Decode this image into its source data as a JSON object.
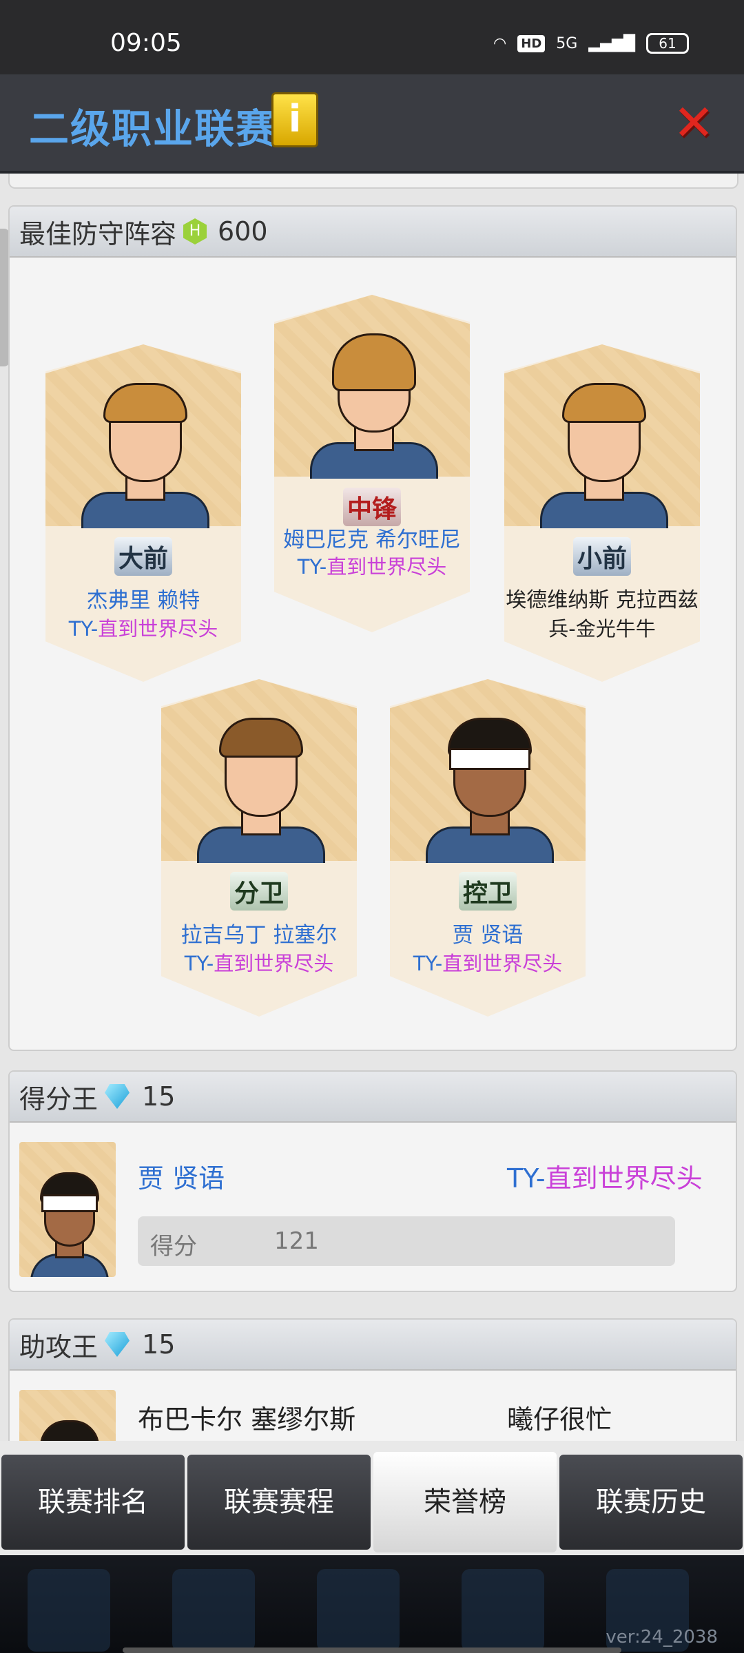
{
  "status_bar": {
    "time": "09:05",
    "network": "5G",
    "hd": "HD",
    "battery": "61"
  },
  "header": {
    "title": "二级职业联赛",
    "info_icon": "i",
    "close_icon": "✕"
  },
  "defense": {
    "title": "最佳防守阵容",
    "badge": "H",
    "points": "600",
    "players": [
      {
        "pos": "大前",
        "name": "杰弗里 赖特",
        "team_ty": "TY-",
        "team_rest": "直到世界尽头"
      },
      {
        "pos": "中锋",
        "name": "姆巴尼克 希尔旺尼",
        "team_ty": "TY-",
        "team_rest": "直到世界尽头"
      },
      {
        "pos": "小前",
        "name": "埃德维纳斯 克拉西兹",
        "team": "兵-金光牛牛"
      },
      {
        "pos": "分卫",
        "name": "拉吉乌丁 拉塞尔",
        "team_ty": "TY-",
        "team_rest": "直到世界尽头"
      },
      {
        "pos": "控卫",
        "name": "贾 贤语",
        "team_ty": "TY-",
        "team_rest": "直到世界尽头"
      }
    ]
  },
  "scoring": {
    "title": "得分王",
    "reward": "15",
    "player": "贾 贤语",
    "team_ty": "TY-",
    "team_rest": "直到世界尽头",
    "stat_label": "得分",
    "stat_value": "121"
  },
  "assists": {
    "title": "助攻王",
    "reward": "15",
    "player": "布巴卡尔 塞缪尔斯",
    "team": "曦仔很忙"
  },
  "tabs": [
    "联赛排名",
    "联赛赛程",
    "荣誉榜",
    "联赛历史"
  ],
  "version": "ver:24_2038",
  "colors": {
    "accent_blue": "#2e6fd1",
    "accent_pink": "#c940d8",
    "header_bg": "#3a3c42"
  }
}
